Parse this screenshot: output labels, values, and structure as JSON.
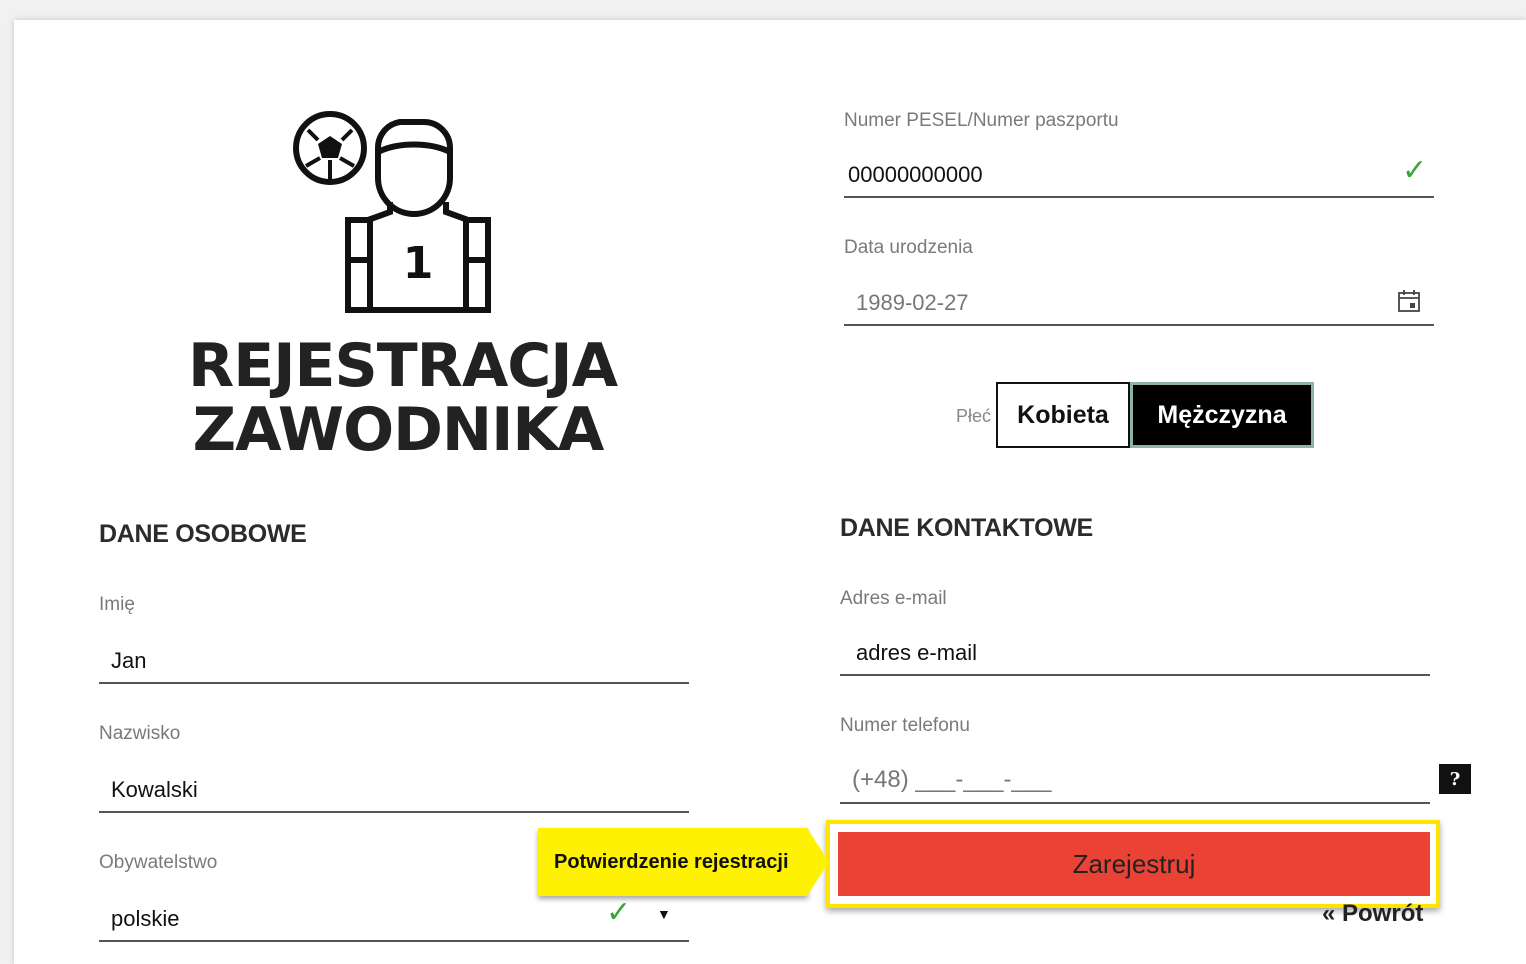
{
  "header": {
    "title_line1": "REJESTRACJA",
    "title_line2": "ZAWODNIKA",
    "logo_number": "1"
  },
  "personal": {
    "heading": "DANE OSOBOWE",
    "first_name_label": "Imię",
    "first_name_value": "Jan",
    "last_name_label": "Nazwisko",
    "last_name_value": "Kowalski",
    "citizenship_label": "Obywatelstwo",
    "citizenship_value": "polskie",
    "pesel_label": "Numer PESEL/Numer paszportu",
    "pesel_value": "00000000000",
    "birthdate_label": "Data urodzenia",
    "birthdate_value": "1989-02-27",
    "gender_label": "Płeć",
    "gender_options": [
      "Kobieta",
      "Mężczyzna"
    ],
    "gender_selected": "Mężczyzna"
  },
  "contact": {
    "heading": "DANE KONTAKTOWE",
    "email_label": "Adres e-mail",
    "email_placeholder": "adres e-mail",
    "phone_label": "Numer telefonu",
    "phone_placeholder": "(+48) ___-___-___",
    "help_label": "?"
  },
  "actions": {
    "submit_label": "Zarejestruj",
    "back_label": "« Powrót"
  },
  "callout": {
    "text": "Potwierdzenie rejestracji"
  },
  "icons": {
    "check": "✓",
    "dropdown": "▼"
  },
  "colors": {
    "submit": "#ea4335",
    "highlight": "#fff200",
    "valid": "#3aa63a",
    "selected_segment": "#000000"
  }
}
